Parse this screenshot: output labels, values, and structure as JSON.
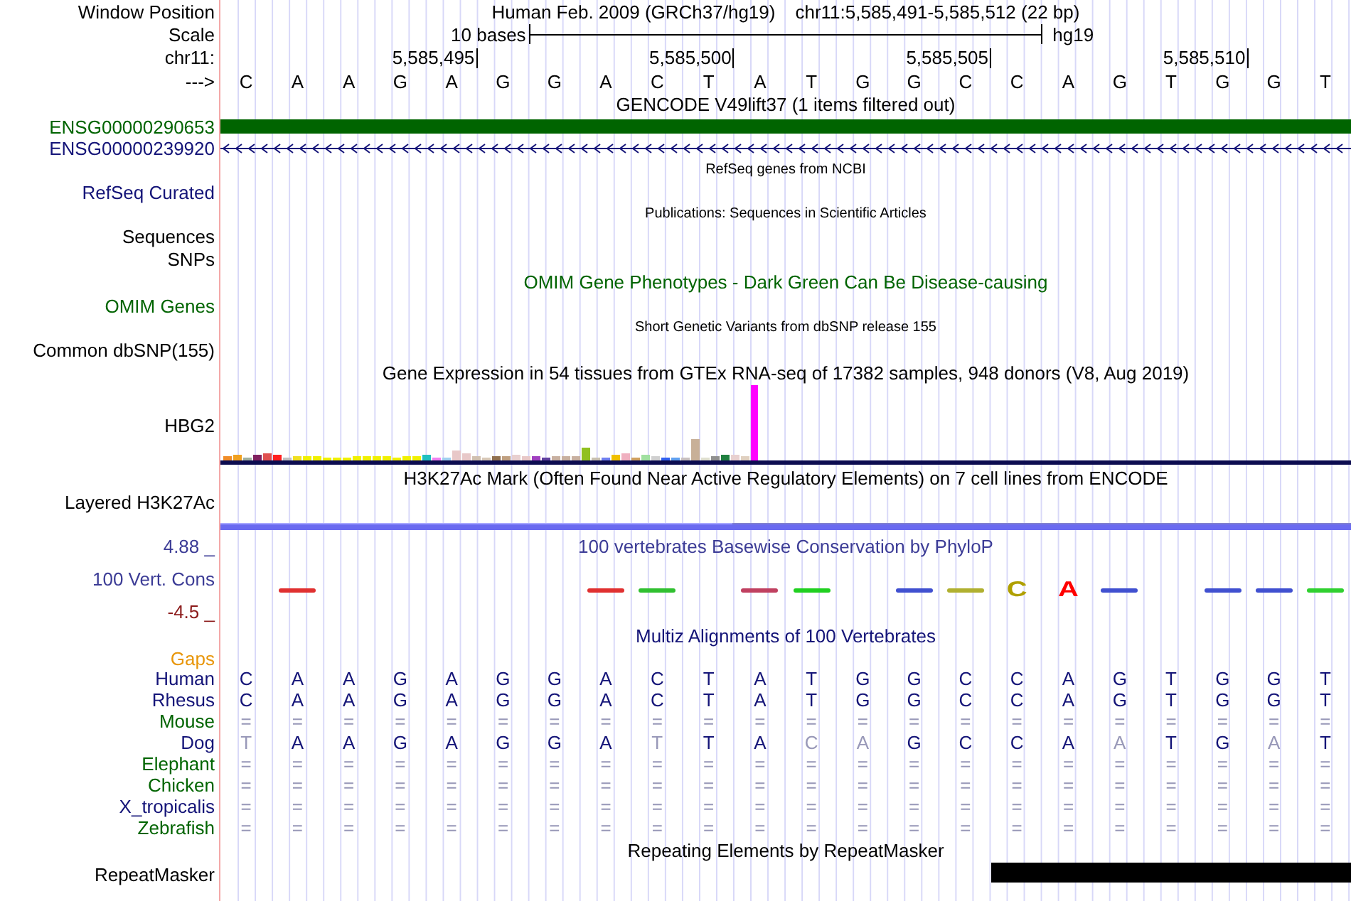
{
  "position": {
    "label": "Window Position",
    "assembly": "Human Feb. 2009 (GRCh37/hg19)",
    "range": "chr11:5,585,491-5,585,512 (22 bp)"
  },
  "scale": {
    "label": "Scale",
    "length": "10 bases",
    "db": "hg19"
  },
  "ruler": {
    "label": "chr11:",
    "ticks": [
      "5,585,495",
      "5,585,500",
      "5,585,505",
      "5,585,510"
    ]
  },
  "sequence": {
    "label": "--->",
    "bases": [
      "C",
      "A",
      "A",
      "G",
      "A",
      "G",
      "G",
      "A",
      "C",
      "T",
      "A",
      "T",
      "G",
      "G",
      "C",
      "C",
      "A",
      "G",
      "T",
      "G",
      "G",
      "T"
    ]
  },
  "tracks": [
    {
      "kind": "title",
      "text": "GENCODE V49lift37 (1 items filtered out)",
      "color": "#000000"
    },
    {
      "kind": "gene_bar",
      "label": "ENSG00000290653",
      "color": "#006400"
    },
    {
      "kind": "gene_line",
      "label": "ENSG00000239920",
      "color": "#141478"
    },
    {
      "kind": "caption",
      "text": "RefSeq genes from NCBI"
    },
    {
      "kind": "label",
      "label": "RefSeq Curated",
      "color": "#141478"
    },
    {
      "kind": "caption",
      "text": "Publications: Sequences in Scientific Articles"
    },
    {
      "kind": "label",
      "label": "Sequences",
      "color": "#000000"
    },
    {
      "kind": "label",
      "label": "SNPs",
      "color": "#000000"
    },
    {
      "kind": "title",
      "text": "OMIM Gene Phenotypes - Dark Green Can Be Disease-causing",
      "color": "#006400"
    },
    {
      "kind": "label",
      "label": "OMIM Genes",
      "color": "#006400"
    },
    {
      "kind": "caption",
      "text": "Short Genetic Variants from dbSNP release 155"
    },
    {
      "kind": "label",
      "label": "Common dbSNP(155)",
      "color": "#000000"
    },
    {
      "kind": "title",
      "text": "Gene Expression in 54 tissues from GTEx RNA-seq of 17382 samples, 948 donors (V8, Aug 2019)",
      "color": "#000000"
    },
    {
      "kind": "expression",
      "label": "HBG2"
    },
    {
      "kind": "title",
      "text": "H3K27Ac Mark (Often Found Near Active Regulatory Elements) on 7 cell lines from ENCODE",
      "color": "#000000"
    },
    {
      "kind": "label",
      "label": "Layered H3K27Ac",
      "color": "#000000"
    },
    {
      "kind": "signal"
    },
    {
      "kind": "conservation",
      "title": "100 vertebrates Basewise Conservation by PhyloP",
      "top": "4.88 _",
      "label": "100 Vert. Cons",
      "bottom": "-4.5 _",
      "columns": [
        {
          "kind": "none"
        },
        {
          "kind": "mark",
          "color": "#e03030"
        },
        {
          "kind": "none"
        },
        {
          "kind": "none"
        },
        {
          "kind": "none"
        },
        {
          "kind": "none"
        },
        {
          "kind": "none"
        },
        {
          "kind": "mark",
          "color": "#e03030"
        },
        {
          "kind": "mark",
          "color": "#30c030"
        },
        {
          "kind": "none"
        },
        {
          "kind": "mark",
          "color": "#c04060"
        },
        {
          "kind": "mark",
          "color": "#20d020"
        },
        {
          "kind": "none"
        },
        {
          "kind": "mark",
          "color": "#4050d0"
        },
        {
          "kind": "mark",
          "color": "#b0b030"
        },
        {
          "kind": "letter",
          "text": "C",
          "color": "#b0a000"
        },
        {
          "kind": "letter",
          "text": "A",
          "color": "#ff0000"
        },
        {
          "kind": "mark",
          "color": "#4050d0"
        },
        {
          "kind": "none"
        },
        {
          "kind": "mark",
          "color": "#4050d0"
        },
        {
          "kind": "mark",
          "color": "#4050d0"
        },
        {
          "kind": "mark",
          "color": "#30d030"
        }
      ]
    },
    {
      "kind": "title",
      "text": "Multiz Alignments of 100 Vertebrates",
      "color": "#141478"
    },
    {
      "kind": "label",
      "label": "Gaps",
      "color": "#e8960a"
    },
    {
      "kind": "alignment",
      "label": "Human",
      "color": "#141478",
      "cells": [
        {
          "base": "C",
          "faded": false
        },
        {
          "base": "A",
          "faded": false
        },
        {
          "base": "A",
          "faded": false
        },
        {
          "base": "G",
          "faded": false
        },
        {
          "base": "A",
          "faded": false
        },
        {
          "base": "G",
          "faded": false
        },
        {
          "base": "G",
          "faded": false
        },
        {
          "base": "A",
          "faded": false
        },
        {
          "base": "C",
          "faded": false
        },
        {
          "base": "T",
          "faded": false
        },
        {
          "base": "A",
          "faded": false
        },
        {
          "base": "T",
          "faded": false
        },
        {
          "base": "G",
          "faded": false
        },
        {
          "base": "G",
          "faded": false
        },
        {
          "base": "C",
          "faded": false
        },
        {
          "base": "C",
          "faded": false
        },
        {
          "base": "A",
          "faded": false
        },
        {
          "base": "G",
          "faded": false
        },
        {
          "base": "T",
          "faded": false
        },
        {
          "base": "G",
          "faded": false
        },
        {
          "base": "G",
          "faded": false
        },
        {
          "base": "T",
          "faded": false
        }
      ]
    },
    {
      "kind": "alignment",
      "label": "Rhesus",
      "color": "#141478",
      "cells": [
        {
          "base": "C",
          "faded": false
        },
        {
          "base": "A",
          "faded": false
        },
        {
          "base": "A",
          "faded": false
        },
        {
          "base": "G",
          "faded": false
        },
        {
          "base": "A",
          "faded": false
        },
        {
          "base": "G",
          "faded": false
        },
        {
          "base": "G",
          "faded": false
        },
        {
          "base": "A",
          "faded": false
        },
        {
          "base": "C",
          "faded": false
        },
        {
          "base": "T",
          "faded": false
        },
        {
          "base": "A",
          "faded": false
        },
        {
          "base": "T",
          "faded": false
        },
        {
          "base": "G",
          "faded": false
        },
        {
          "base": "G",
          "faded": false
        },
        {
          "base": "C",
          "faded": false
        },
        {
          "base": "C",
          "faded": false
        },
        {
          "base": "A",
          "faded": false
        },
        {
          "base": "G",
          "faded": false
        },
        {
          "base": "T",
          "faded": false
        },
        {
          "base": "G",
          "faded": false
        },
        {
          "base": "G",
          "faded": false
        },
        {
          "base": "T",
          "faded": false
        }
      ]
    },
    {
      "kind": "alignment",
      "label": "Mouse",
      "color": "#006400",
      "cells": [
        {
          "base": "=",
          "faded": true
        },
        {
          "base": "=",
          "faded": true
        },
        {
          "base": "=",
          "faded": true
        },
        {
          "base": "=",
          "faded": true
        },
        {
          "base": "=",
          "faded": true
        },
        {
          "base": "=",
          "faded": true
        },
        {
          "base": "=",
          "faded": true
        },
        {
          "base": "=",
          "faded": true
        },
        {
          "base": "=",
          "faded": true
        },
        {
          "base": "=",
          "faded": true
        },
        {
          "base": "=",
          "faded": true
        },
        {
          "base": "=",
          "faded": true
        },
        {
          "base": "=",
          "faded": true
        },
        {
          "base": "=",
          "faded": true
        },
        {
          "base": "=",
          "faded": true
        },
        {
          "base": "=",
          "faded": true
        },
        {
          "base": "=",
          "faded": true
        },
        {
          "base": "=",
          "faded": true
        },
        {
          "base": "=",
          "faded": true
        },
        {
          "base": "=",
          "faded": true
        },
        {
          "base": "=",
          "faded": true
        },
        {
          "base": "=",
          "faded": true
        }
      ]
    },
    {
      "kind": "alignment",
      "label": "Dog",
      "color": "#141478",
      "cells": [
        {
          "base": "T",
          "faded": true
        },
        {
          "base": "A",
          "faded": false
        },
        {
          "base": "A",
          "faded": false
        },
        {
          "base": "G",
          "faded": false
        },
        {
          "base": "A",
          "faded": false
        },
        {
          "base": "G",
          "faded": false
        },
        {
          "base": "G",
          "faded": false
        },
        {
          "base": "A",
          "faded": false
        },
        {
          "base": "T",
          "faded": true
        },
        {
          "base": "T",
          "faded": false
        },
        {
          "base": "A",
          "faded": false
        },
        {
          "base": "C",
          "faded": true
        },
        {
          "base": "A",
          "faded": true
        },
        {
          "base": "G",
          "faded": false
        },
        {
          "base": "C",
          "faded": false
        },
        {
          "base": "C",
          "faded": false
        },
        {
          "base": "A",
          "faded": false
        },
        {
          "base": "A",
          "faded": true
        },
        {
          "base": "T",
          "faded": false
        },
        {
          "base": "G",
          "faded": false
        },
        {
          "base": "A",
          "faded": true
        },
        {
          "base": "T",
          "faded": false
        }
      ]
    },
    {
      "kind": "alignment",
      "label": "Elephant",
      "color": "#006400",
      "cells": [
        {
          "base": "=",
          "faded": true
        },
        {
          "base": "=",
          "faded": true
        },
        {
          "base": "=",
          "faded": true
        },
        {
          "base": "=",
          "faded": true
        },
        {
          "base": "=",
          "faded": true
        },
        {
          "base": "=",
          "faded": true
        },
        {
          "base": "=",
          "faded": true
        },
        {
          "base": "=",
          "faded": true
        },
        {
          "base": "=",
          "faded": true
        },
        {
          "base": "=",
          "faded": true
        },
        {
          "base": "=",
          "faded": true
        },
        {
          "base": "=",
          "faded": true
        },
        {
          "base": "=",
          "faded": true
        },
        {
          "base": "=",
          "faded": true
        },
        {
          "base": "=",
          "faded": true
        },
        {
          "base": "=",
          "faded": true
        },
        {
          "base": "=",
          "faded": true
        },
        {
          "base": "=",
          "faded": true
        },
        {
          "base": "=",
          "faded": true
        },
        {
          "base": "=",
          "faded": true
        },
        {
          "base": "=",
          "faded": true
        },
        {
          "base": "=",
          "faded": true
        }
      ]
    },
    {
      "kind": "alignment",
      "label": "Chicken",
      "color": "#006400",
      "cells": [
        {
          "base": "=",
          "faded": true
        },
        {
          "base": "=",
          "faded": true
        },
        {
          "base": "=",
          "faded": true
        },
        {
          "base": "=",
          "faded": true
        },
        {
          "base": "=",
          "faded": true
        },
        {
          "base": "=",
          "faded": true
        },
        {
          "base": "=",
          "faded": true
        },
        {
          "base": "=",
          "faded": true
        },
        {
          "base": "=",
          "faded": true
        },
        {
          "base": "=",
          "faded": true
        },
        {
          "base": "=",
          "faded": true
        },
        {
          "base": "=",
          "faded": true
        },
        {
          "base": "=",
          "faded": true
        },
        {
          "base": "=",
          "faded": true
        },
        {
          "base": "=",
          "faded": true
        },
        {
          "base": "=",
          "faded": true
        },
        {
          "base": "=",
          "faded": true
        },
        {
          "base": "=",
          "faded": true
        },
        {
          "base": "=",
          "faded": true
        },
        {
          "base": "=",
          "faded": true
        },
        {
          "base": "=",
          "faded": true
        },
        {
          "base": "=",
          "faded": true
        }
      ]
    },
    {
      "kind": "alignment",
      "label": "X_tropicalis",
      "color": "#141478",
      "cells": [
        {
          "base": "=",
          "faded": true
        },
        {
          "base": "=",
          "faded": true
        },
        {
          "base": "=",
          "faded": true
        },
        {
          "base": "=",
          "faded": true
        },
        {
          "base": "=",
          "faded": true
        },
        {
          "base": "=",
          "faded": true
        },
        {
          "base": "=",
          "faded": true
        },
        {
          "base": "=",
          "faded": true
        },
        {
          "base": "=",
          "faded": true
        },
        {
          "base": "=",
          "faded": true
        },
        {
          "base": "=",
          "faded": true
        },
        {
          "base": "=",
          "faded": true
        },
        {
          "base": "=",
          "faded": true
        },
        {
          "base": "=",
          "faded": true
        },
        {
          "base": "=",
          "faded": true
        },
        {
          "base": "=",
          "faded": true
        },
        {
          "base": "=",
          "faded": true
        },
        {
          "base": "=",
          "faded": true
        },
        {
          "base": "=",
          "faded": true
        },
        {
          "base": "=",
          "faded": true
        },
        {
          "base": "=",
          "faded": true
        },
        {
          "base": "=",
          "faded": true
        }
      ]
    },
    {
      "kind": "alignment",
      "label": "Zebrafish",
      "color": "#006400",
      "cells": [
        {
          "base": "=",
          "faded": true
        },
        {
          "base": "=",
          "faded": true
        },
        {
          "base": "=",
          "faded": true
        },
        {
          "base": "=",
          "faded": true
        },
        {
          "base": "=",
          "faded": true
        },
        {
          "base": "=",
          "faded": true
        },
        {
          "base": "=",
          "faded": true
        },
        {
          "base": "=",
          "faded": true
        },
        {
          "base": "=",
          "faded": true
        },
        {
          "base": "=",
          "faded": true
        },
        {
          "base": "=",
          "faded": true
        },
        {
          "base": "=",
          "faded": true
        },
        {
          "base": "=",
          "faded": true
        },
        {
          "base": "=",
          "faded": true
        },
        {
          "base": "=",
          "faded": true
        },
        {
          "base": "=",
          "faded": true
        },
        {
          "base": "=",
          "faded": true
        },
        {
          "base": "=",
          "faded": true
        },
        {
          "base": "=",
          "faded": true
        },
        {
          "base": "=",
          "faded": true
        },
        {
          "base": "=",
          "faded": true
        },
        {
          "base": "=",
          "faded": true
        }
      ]
    },
    {
      "kind": "title",
      "text": "Repeating Elements by RepeatMasker",
      "color": "#000000"
    },
    {
      "kind": "repeat",
      "label": "RepeatMasker"
    }
  ]
}
